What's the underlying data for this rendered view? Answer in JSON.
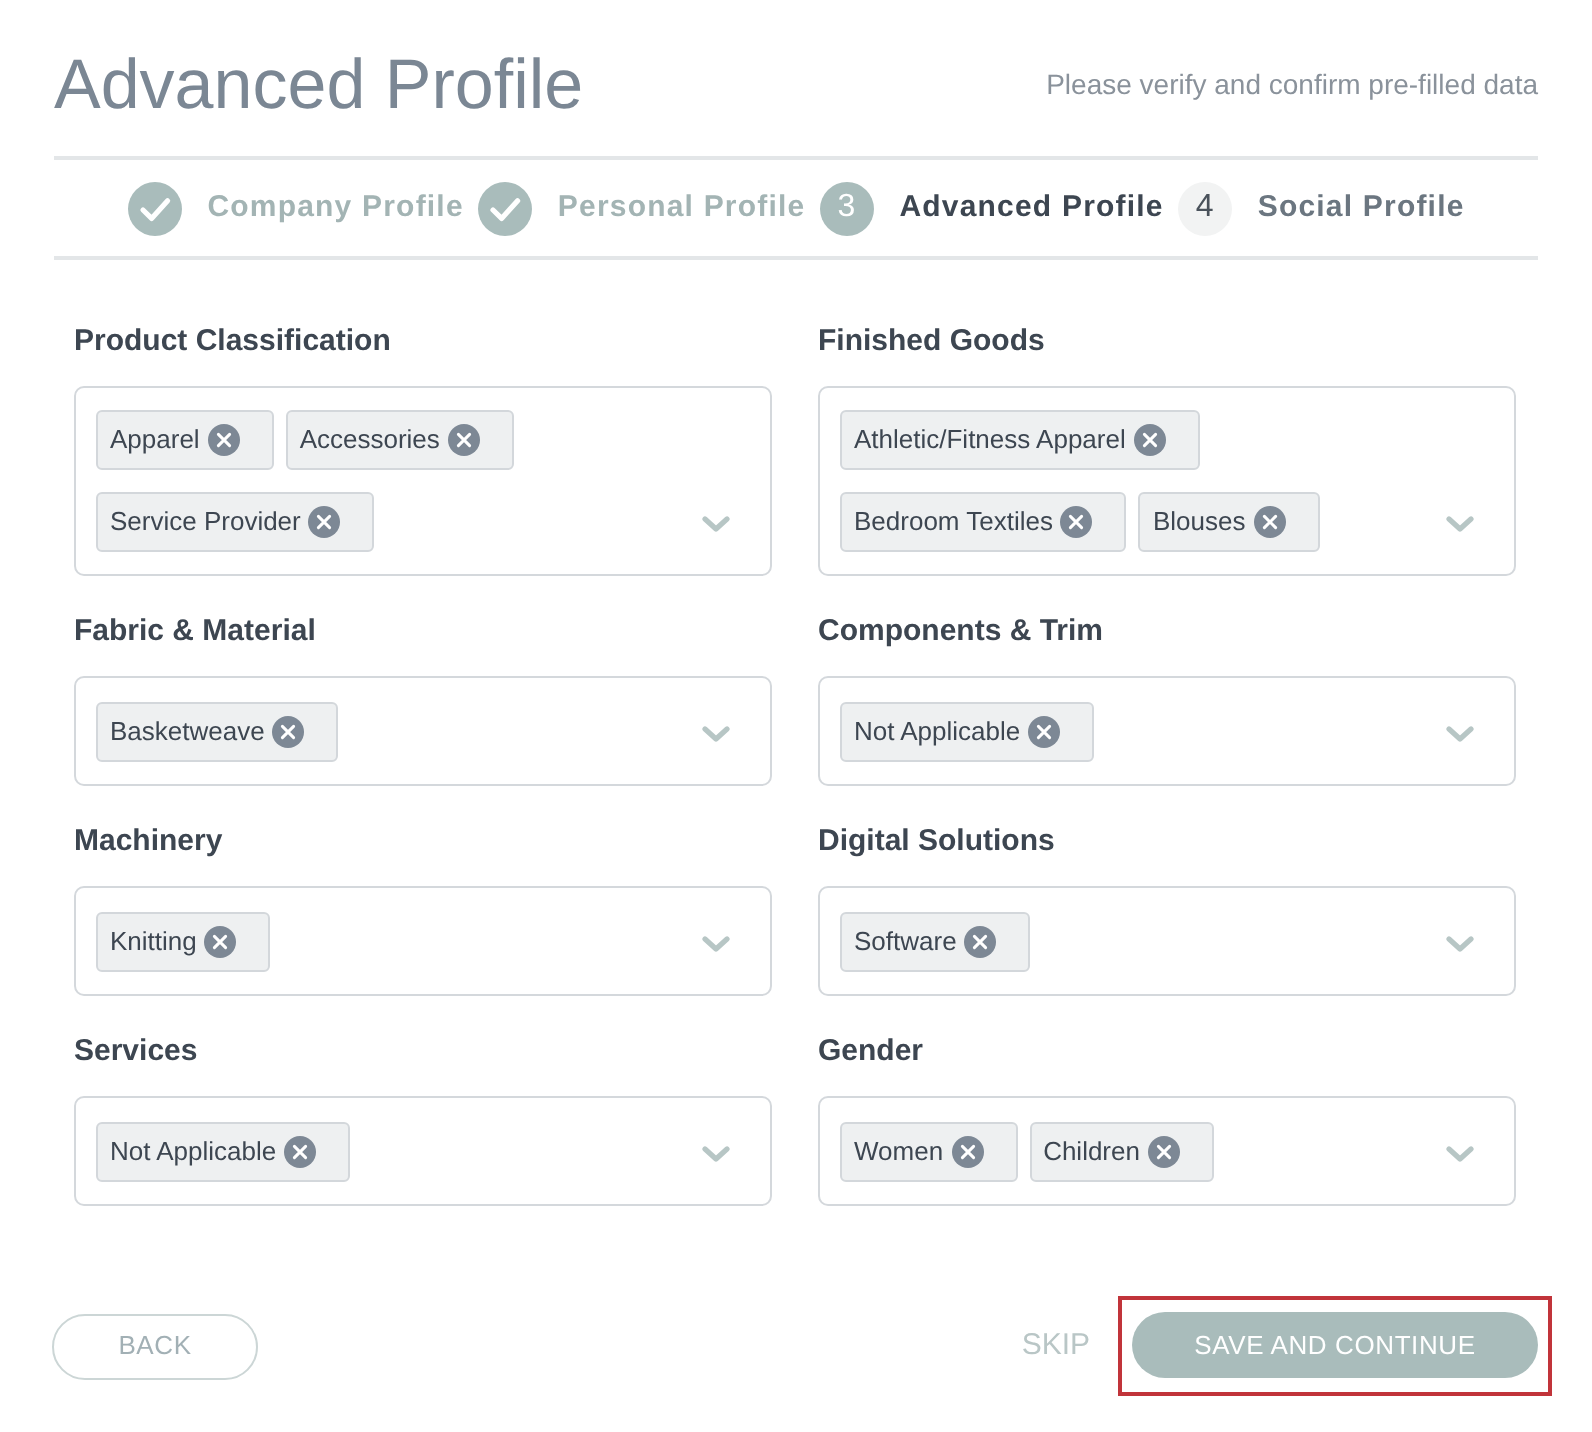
{
  "header": {
    "title": "Advanced Profile",
    "subtitle": "Please verify and confirm pre-filled data"
  },
  "steps": [
    {
      "label": "Company Profile",
      "done": true,
      "selected": false
    },
    {
      "label": "Personal Profile",
      "done": true,
      "selected": false
    },
    {
      "number": "3",
      "label": "Advanced Profile",
      "done": false,
      "selected": true
    },
    {
      "number": "4",
      "label": "Social Profile",
      "done": false,
      "selected": false
    }
  ],
  "fields": [
    {
      "label": "Product Classification",
      "tags": [
        "Apparel",
        "Accessories",
        "Service Provider"
      ]
    },
    {
      "label": "Finished Goods",
      "tags": [
        "Athletic/Fitness Apparel",
        "Bedroom Textiles",
        "Blouses"
      ]
    },
    {
      "label": "Fabric & Material",
      "tags": [
        "Basketweave"
      ]
    },
    {
      "label": "Components & Trim",
      "tags": [
        "Not Applicable"
      ]
    },
    {
      "label": "Machinery",
      "tags": [
        "Knitting"
      ]
    },
    {
      "label": "Digital Solutions",
      "tags": [
        "Software"
      ]
    },
    {
      "label": "Services",
      "tags": [
        "Not Applicable"
      ]
    },
    {
      "label": "Gender",
      "tags": [
        "Women",
        "Children"
      ]
    }
  ],
  "actions": [
    {
      "kind": "outline",
      "label": "BACK",
      "highlighted": false
    },
    {
      "kind": "link",
      "label": "SKIP",
      "highlighted": false
    },
    {
      "kind": "primary",
      "label": "SAVE AND CONTINUE",
      "highlighted": true
    }
  ]
}
